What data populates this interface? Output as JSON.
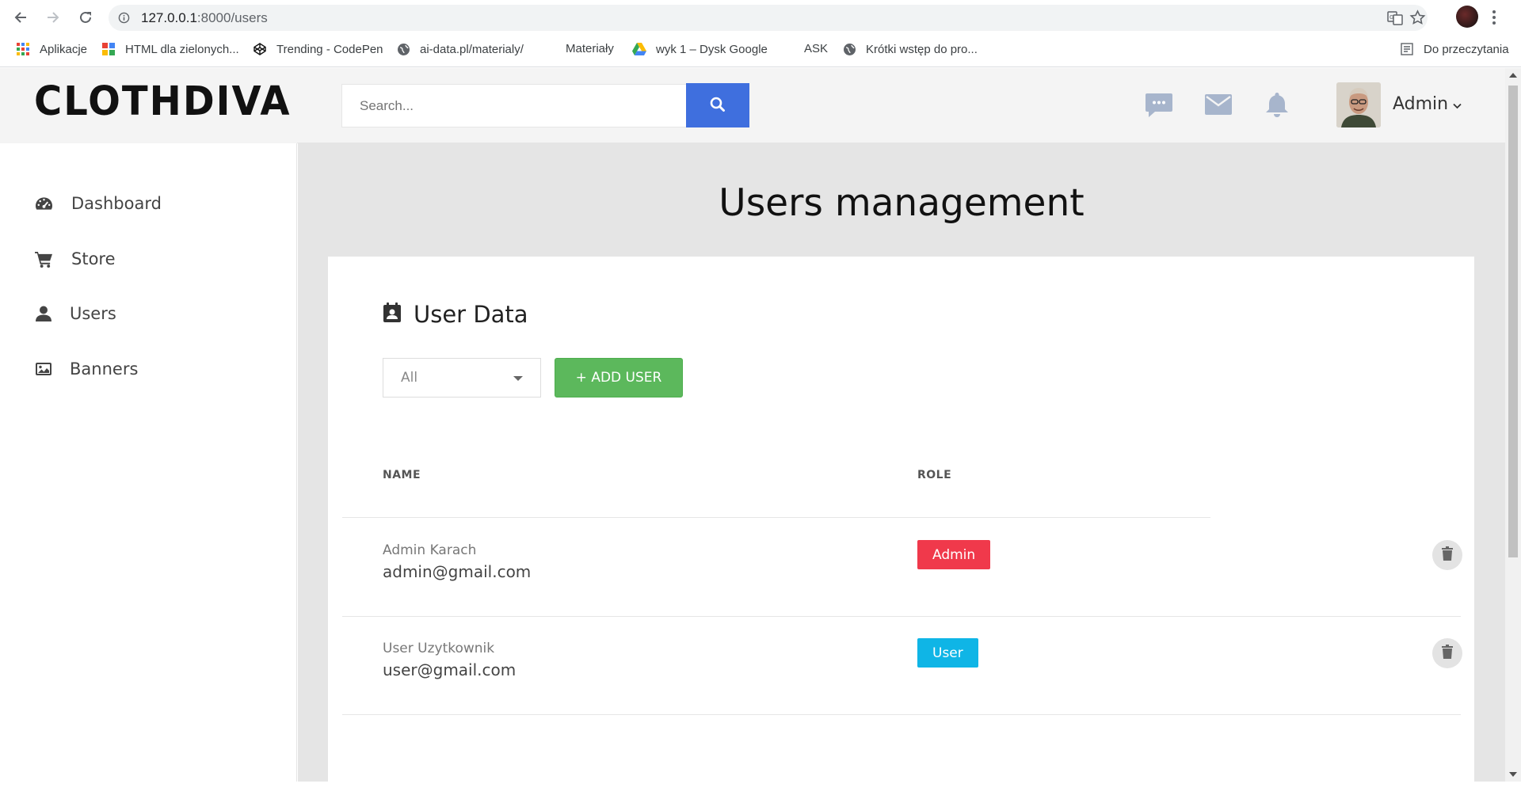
{
  "browser": {
    "url_host": "127.0.0.1",
    "url_rest": ":8000/users",
    "bookmarks": [
      {
        "label": "Aplikacje",
        "icon": "apps-grid-icon"
      },
      {
        "label": "HTML dla zielonych...",
        "icon": "site-favicon-icon"
      },
      {
        "label": "Trending - CodePen",
        "icon": "codepen-icon"
      },
      {
        "label": "ai-data.pl/materialy/",
        "icon": "globe-icon"
      },
      {
        "label": "Materiały",
        "icon": ""
      },
      {
        "label": "wyk 1 – Dysk Google",
        "icon": "google-drive-icon"
      },
      {
        "label": "ASK",
        "icon": ""
      },
      {
        "label": "Krótki wstęp do pro...",
        "icon": "globe-icon"
      },
      {
        "label": "Do przeczytania",
        "icon": "reading-list-icon"
      }
    ]
  },
  "brand": {
    "logo": "CLOTHDIVA"
  },
  "header": {
    "search_placeholder": "Search...",
    "user_name": "Admin"
  },
  "sidebar": {
    "items": [
      {
        "label": "Dashboard",
        "icon": "dashboard-gauge-icon"
      },
      {
        "label": "Store",
        "icon": "cart-icon"
      },
      {
        "label": "Users",
        "icon": "user-icon"
      },
      {
        "label": "Banners",
        "icon": "image-icon"
      }
    ]
  },
  "main": {
    "title": "Users management",
    "card_title": "User Data",
    "filter_value": "All",
    "add_button": "+ ADD USER",
    "columns": {
      "name": "NAME",
      "role": "ROLE"
    },
    "rows": [
      {
        "name": "Admin Karach",
        "email": "admin@gmail.com",
        "role": "Admin",
        "role_color": "#f0394b"
      },
      {
        "name": "User Uzytkownik",
        "email": "user@gmail.com",
        "role": "User",
        "role_color": "#0fb5e6"
      }
    ]
  },
  "colors": {
    "primary": "#3f6fde",
    "success": "#5cb85c",
    "header_icons": "#a7b5cc"
  }
}
